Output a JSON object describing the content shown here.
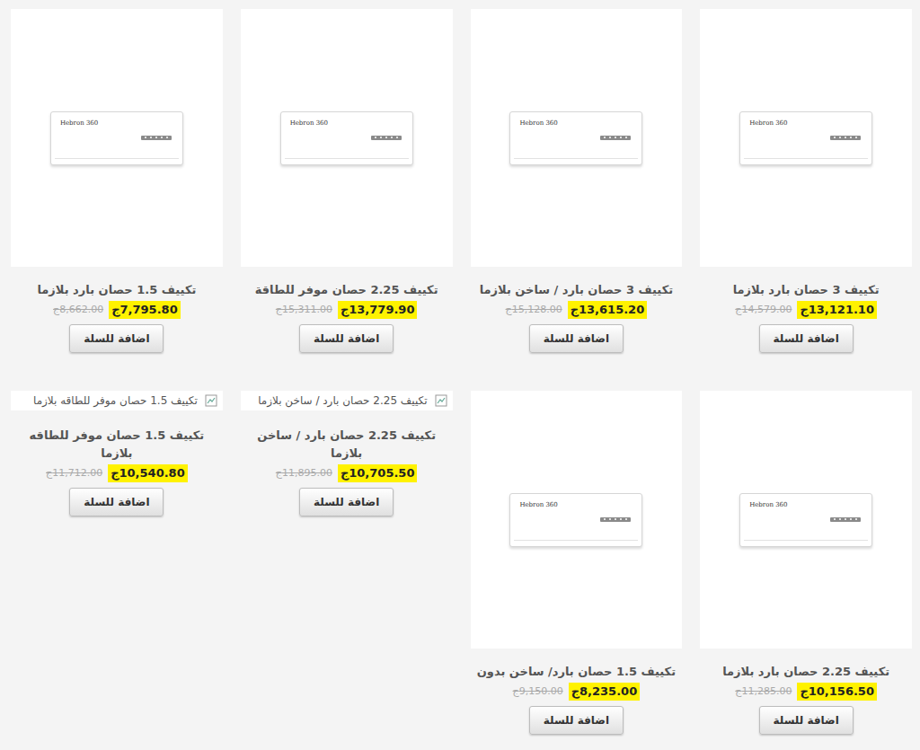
{
  "products": [
    {
      "title": "تكييف 3 حصان بارد بلازما",
      "price": "13,121.10ج",
      "old_price": "14,579.00ج",
      "image": {
        "kind": "photo",
        "brand": "Hebron 360"
      },
      "button": "اضافة للسلة"
    },
    {
      "title": "تكييف 3 حصان بارد / ساخن بلازما",
      "price": "13,615.20ج",
      "old_price": "15,128.00ج",
      "image": {
        "kind": "photo",
        "brand": "Hebron 360"
      },
      "button": "اضافة للسلة"
    },
    {
      "title": "تكييف 2.25 حصان موفر للطاقة",
      "price": "13,779.90ج",
      "old_price": "15,311.00ج",
      "image": {
        "kind": "photo",
        "brand": "Hebron 360"
      },
      "button": "اضافة للسلة"
    },
    {
      "title": "تكييف 1.5 حصان بارد بلازما",
      "price": "7,795.80ج",
      "old_price": "8,662.00ج",
      "image": {
        "kind": "photo",
        "brand": "Hebron 360"
      },
      "button": "اضافة للسلة"
    },
    {
      "title": "تكييف 2.25 حصان بارد بلازما",
      "price": "10,156.50ج",
      "old_price": "11,285.00ج",
      "image": {
        "kind": "photo",
        "brand": "Hebron 360"
      },
      "button": "اضافة للسلة"
    },
    {
      "title": "تكييف 1.5 حصان بارد/ ساخن بدون",
      "price": "8,235.00ج",
      "old_price": "9,150.00ج",
      "image": {
        "kind": "photo",
        "brand": "Hebron 360"
      },
      "button": "اضافة للسلة"
    },
    {
      "title": "تكييف 2.25 حصان بارد / ساخن بلازما",
      "price": "10,705.50ج",
      "old_price": "11,895.00ج",
      "image": {
        "kind": "broken",
        "alt": "تكييف 2.25 حصان بارد / ساخن بلازما"
      },
      "button": "اضافة للسلة"
    },
    {
      "title": "تكييف 1.5 حصان موفر للطاقه بلازما",
      "price": "10,540.80ج",
      "old_price": "11,712.00ج",
      "image": {
        "kind": "broken",
        "alt": "تكييف 1.5 حصان موفر للطاقه بلازما"
      },
      "button": "اضافة للسلة"
    }
  ]
}
